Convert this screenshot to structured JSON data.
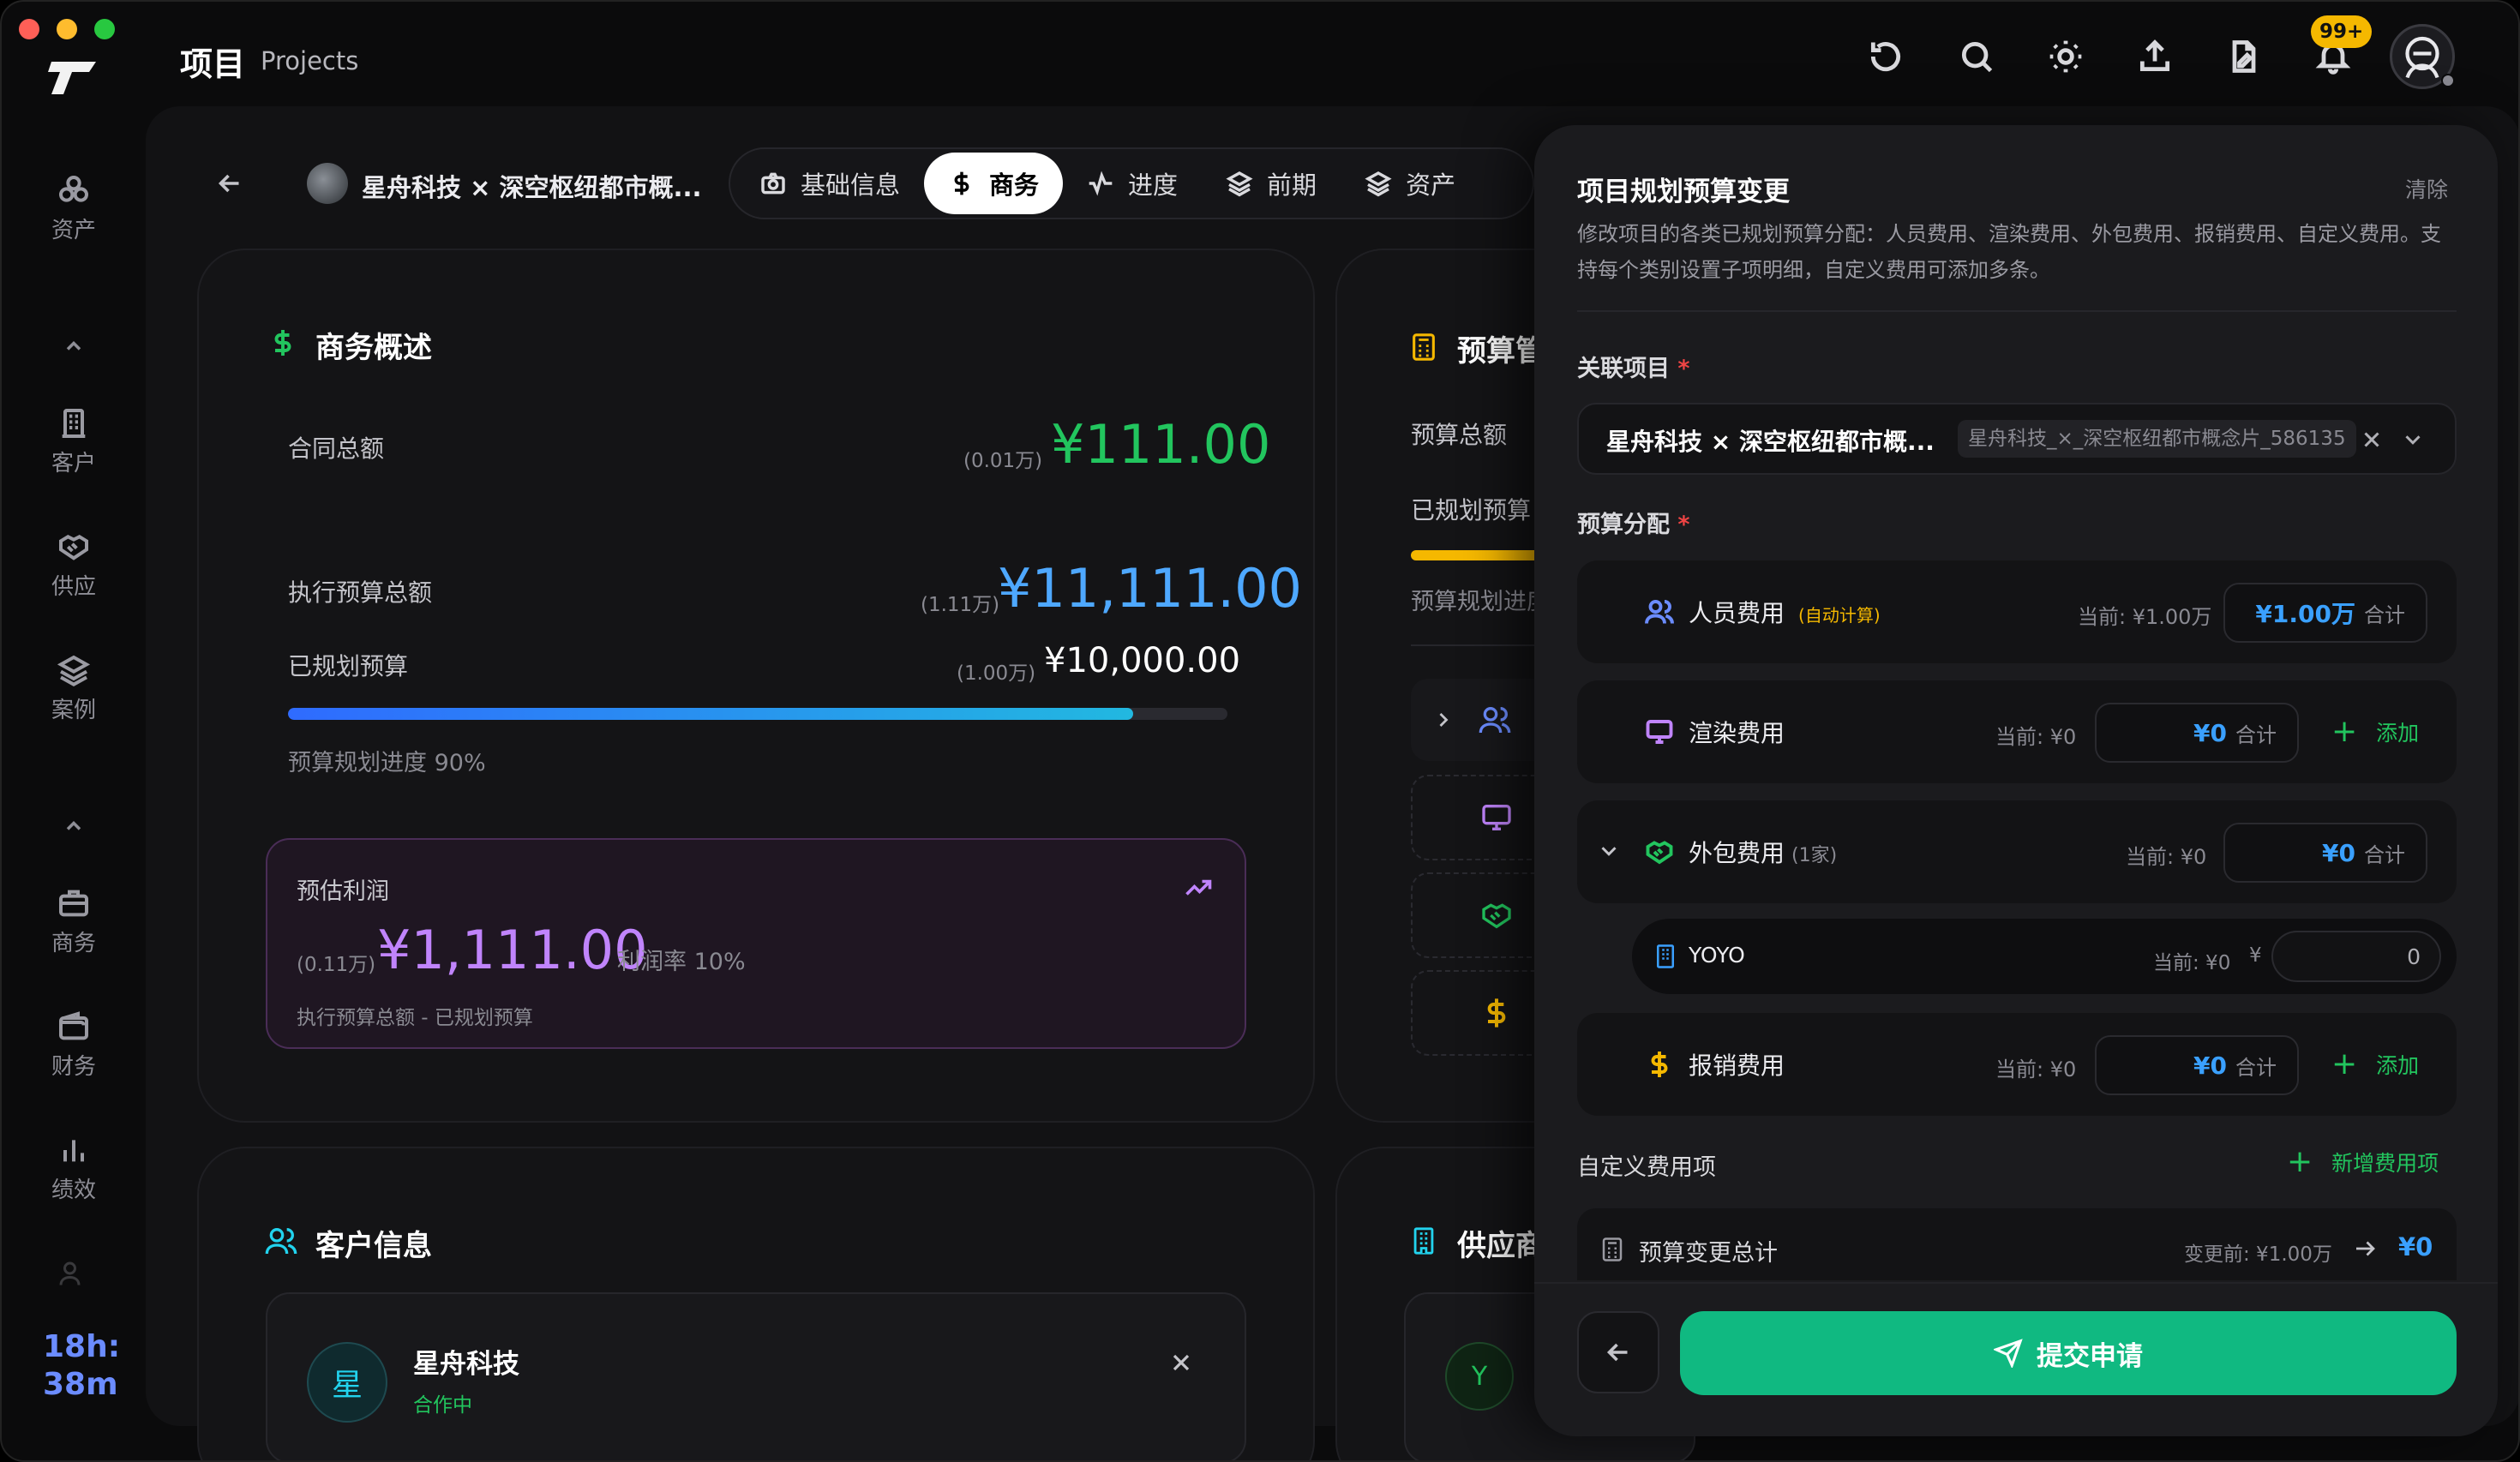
{
  "app": {
    "title": "项目",
    "subtitle": "Projects",
    "notification_badge": "99+",
    "timer": [
      "18h:",
      "38m"
    ]
  },
  "sidebar": {
    "items": [
      {
        "label": "资产",
        "icon": "assets-icon"
      },
      {
        "label": "客户",
        "icon": "building-icon"
      },
      {
        "label": "供应",
        "icon": "handshake-icon"
      },
      {
        "label": "案例",
        "icon": "layers-icon"
      },
      {
        "label": "商务",
        "icon": "briefcase-icon"
      },
      {
        "label": "财务",
        "icon": "wallet-icon"
      },
      {
        "label": "绩效",
        "icon": "bar-chart-icon"
      }
    ]
  },
  "header": {
    "project_name": "星舟科技 × 深空枢纽都市概...",
    "tabs": [
      {
        "label": "基础信息",
        "icon": "camera-icon"
      },
      {
        "label": "商务",
        "icon": "dollar-icon",
        "active": true
      },
      {
        "label": "进度",
        "icon": "activity-icon"
      },
      {
        "label": "前期",
        "icon": "layers-icon"
      },
      {
        "label": "资产",
        "icon": "layers-icon"
      }
    ]
  },
  "business_overview": {
    "title": "商务概述",
    "contract_total_label": "合同总额",
    "contract_total_hint": "(0.01万)",
    "contract_total_value": "¥111.00",
    "exec_budget_label": "执行预算总额",
    "exec_budget_hint": "(1.11万)",
    "exec_budget_value": "¥11,111.00",
    "planned_label": "已规划预算",
    "planned_hint": "(1.00万)",
    "planned_value": "¥10,000.00",
    "progress_text": "预算规划进度 90%",
    "progress_fraction": 0.9,
    "profit_label": "预估利润",
    "profit_hint": "(0.11万)",
    "profit_value": "¥1,111.00",
    "profit_rate": "利润率 10%",
    "profit_formula": "执行预算总额 - 已规划预算"
  },
  "budget_card": {
    "title": "预算管",
    "total_label": "预算总额",
    "planned_label": "已规划预算",
    "progress_label": "预算规划进度"
  },
  "customer_card": {
    "title": "客户信息",
    "customer_initial": "星",
    "customer_name": "星舟科技",
    "customer_status": "合作中"
  },
  "supplier_card": {
    "title": "供应商",
    "supplier_initial": "Y"
  },
  "panel": {
    "title": "项目规划预算变更",
    "clear": "清除",
    "description": "修改项目的各类已规划预算分配：人员费用、渲染费用、外包费用、报销费用、自定义费用。支持每个类别设置子项明细，自定义费用可添加多条。",
    "related_label": "关联项目",
    "related_value": "星舟科技 × 深空枢纽都市概...",
    "related_tag": "星舟科技_×_深空枢纽都市概念片_586135",
    "allocation_label": "预算分配",
    "personnel": {
      "name": "人员费用",
      "auto": "(自动计算)",
      "current": "当前: ¥1.00万",
      "amount": "¥1.00万",
      "unit": "合计"
    },
    "render": {
      "name": "渲染费用",
      "current": "当前: ¥0",
      "amount": "¥0",
      "unit": "合计",
      "add": "添加"
    },
    "outsourcing": {
      "name": "外包费用",
      "count": "(1家)",
      "current": "当前: ¥0",
      "amount": "¥0",
      "unit": "合计"
    },
    "vendor": {
      "name": "YOYO",
      "current": "当前: ¥0",
      "currency": "¥",
      "value": "0"
    },
    "reimbursement": {
      "name": "报销费用",
      "current": "当前: ¥0",
      "amount": "¥0",
      "unit": "合计",
      "add": "添加"
    },
    "custom_label": "自定义费用项",
    "custom_add": "新增费用项",
    "summary_label": "预算变更总计",
    "summary_before": "变更前: ¥1.00万",
    "summary_after": "¥0",
    "submit": "提交申请"
  }
}
